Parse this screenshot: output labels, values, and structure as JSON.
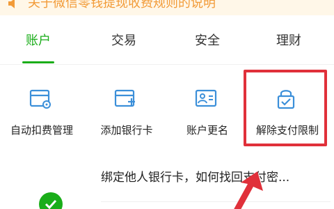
{
  "notice": {
    "text": "关于微信零钱提现收费规则的说明",
    "icon": "speaker-icon"
  },
  "tabs": [
    {
      "label": "账户",
      "active": true
    },
    {
      "label": "交易",
      "active": false
    },
    {
      "label": "安全",
      "active": false
    },
    {
      "label": "理财",
      "active": false
    }
  ],
  "features": [
    {
      "label": "自动扣费管理",
      "icon": "auto-deduct-icon"
    },
    {
      "label": "添加银行卡",
      "icon": "add-card-icon"
    },
    {
      "label": "账户更名",
      "icon": "rename-account-icon"
    },
    {
      "label": "解除支付限制",
      "icon": "unlock-payment-icon"
    }
  ],
  "list": {
    "first_item": "绑定他人银行卡，如何找回支付密..."
  },
  "colors": {
    "brand_green": "#1aad19",
    "notice_orange": "#f29b38",
    "highlight_red": "#e0303a",
    "icon_blue": "#3b8fd9"
  }
}
